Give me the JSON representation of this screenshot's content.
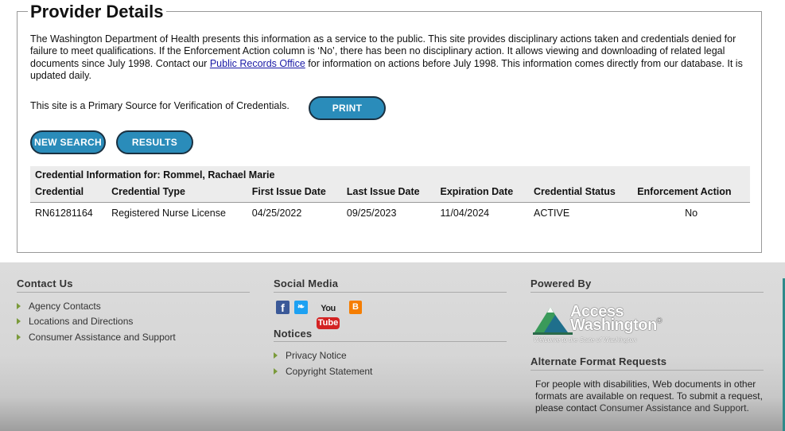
{
  "provider": {
    "title": "Provider Details",
    "intro_part1": "The Washington Department of Health presents this information as a service to the public. This site provides disciplinary actions taken and credentials denied for failure to meet qualifications. If the Enforcement Action column is ‘No’, there has been no disciplinary action. It allows viewing and downloading of related legal documents since July 1998. Contact our ",
    "intro_link": "Public Records Office",
    "intro_part2": " for information on actions before July 1998. This information comes directly from our database. It is updated daily.",
    "primary_source": "This site is a Primary Source for Verification of Credentials.",
    "print_label": "PRINT",
    "new_search_label": "NEW SEARCH",
    "results_label": "RESULTS"
  },
  "credentials": {
    "caption": "Credential Information for: Rommel, Rachael Marie",
    "headers": [
      "Credential",
      "Credential Type",
      "First Issue Date",
      "Last Issue Date",
      "Expiration Date",
      "Credential Status",
      "Enforcement Action"
    ],
    "rows": [
      [
        "RN61281164",
        "Registered Nurse License",
        "04/25/2022",
        "09/25/2023",
        "11/04/2024",
        "ACTIVE",
        "No"
      ]
    ]
  },
  "footer": {
    "contact_title": "Contact Us",
    "contact_links": [
      "Agency Contacts",
      "Locations and Directions",
      "Consumer Assistance and Support"
    ],
    "social_title": "Social Media",
    "social_icons": [
      "facebook-icon",
      "twitter-icon",
      "youtube-icon",
      "blogger-icon"
    ],
    "youtube_you": "You",
    "youtube_tube": "Tube",
    "notices_title": "Notices",
    "notices_links": [
      "Privacy Notice",
      "Copyright Statement"
    ],
    "powered_title": "Powered By",
    "logo_line1": "Access",
    "logo_line2": "Washington",
    "logo_tagline": "Welcome to the State of Washington",
    "alt_title": "Alternate Format Requests",
    "alt_text": "For people with disabilities, Web documents in other formats are available on request. To submit a request, please contact ",
    "alt_link": "Consumer Assistance and Support."
  },
  "colors": {
    "button_fill": "#2a8cba",
    "link_blue": "#1a1aa6",
    "bullet_green": "#7a9a3a",
    "footer_bg": "#d9d9d9"
  }
}
